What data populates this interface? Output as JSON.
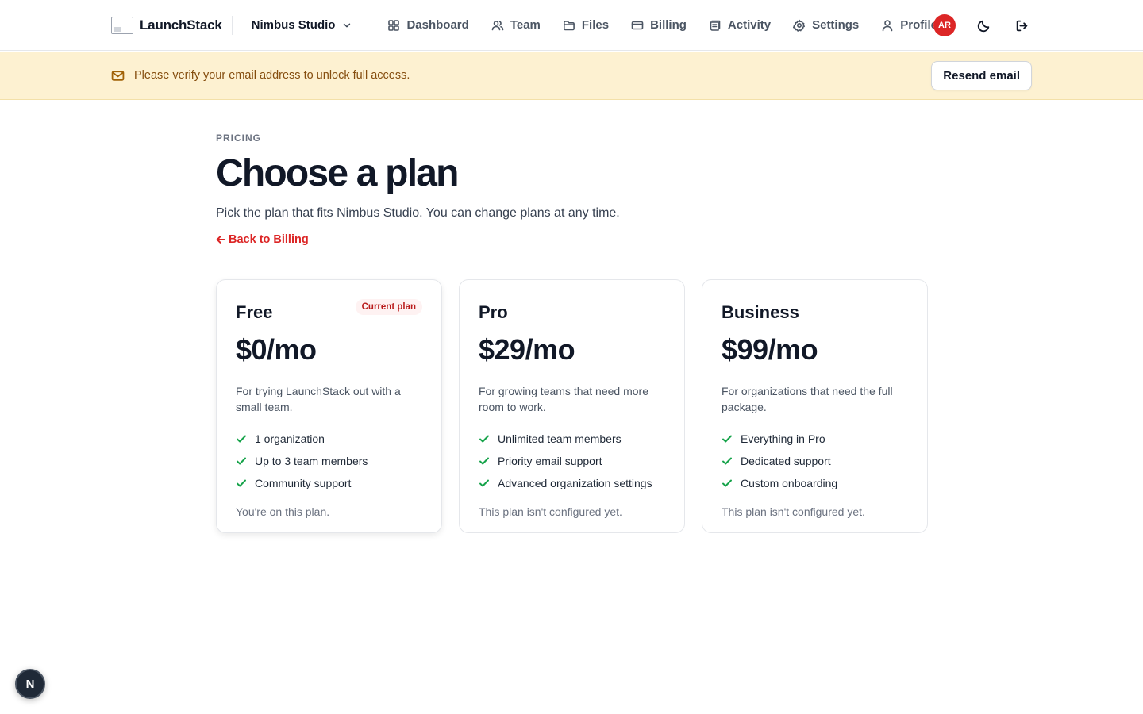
{
  "header": {
    "brand": "LaunchStack",
    "org": "Nimbus Studio",
    "nav": [
      {
        "label": "Dashboard",
        "icon": "dashboard-icon"
      },
      {
        "label": "Team",
        "icon": "users-icon"
      },
      {
        "label": "Files",
        "icon": "folder-icon"
      },
      {
        "label": "Billing",
        "icon": "credit-card-icon"
      },
      {
        "label": "Activity",
        "icon": "activity-log-icon"
      },
      {
        "label": "Settings",
        "icon": "gear-icon"
      },
      {
        "label": "Profile",
        "icon": "user-icon"
      }
    ],
    "avatar_initials": "AR",
    "avatar_color": "#dc2626"
  },
  "banner": {
    "message": "Please verify your email address to unlock full access.",
    "button_label": "Resend email",
    "background": "#fdf1d1"
  },
  "main": {
    "eyebrow": "PRICING",
    "title": "Choose a plan",
    "subtitle": "Pick the plan that fits Nimbus Studio. You can change plans at any time.",
    "back_label": "Back to Billing",
    "accent": "#dc2626"
  },
  "plans": [
    {
      "name": "Free",
      "price": "$0/mo",
      "description": "For trying LaunchStack out with a small team.",
      "features": [
        "1 organization",
        "Up to 3 team members",
        "Community support"
      ],
      "status": "You're on this plan.",
      "badge": "Current plan"
    },
    {
      "name": "Pro",
      "price": "$29/mo",
      "description": "For growing teams that need more room to work.",
      "features": [
        "Unlimited team members",
        "Priority email support",
        "Advanced organization settings"
      ],
      "status": "This plan isn't configured yet."
    },
    {
      "name": "Business",
      "price": "$99/mo",
      "description": "For organizations that need the full package.",
      "features": [
        "Everything in Pro",
        "Dedicated support",
        "Custom onboarding"
      ],
      "status": "This plan isn't configured yet."
    }
  ],
  "floating_badge": {
    "letter": "N"
  }
}
